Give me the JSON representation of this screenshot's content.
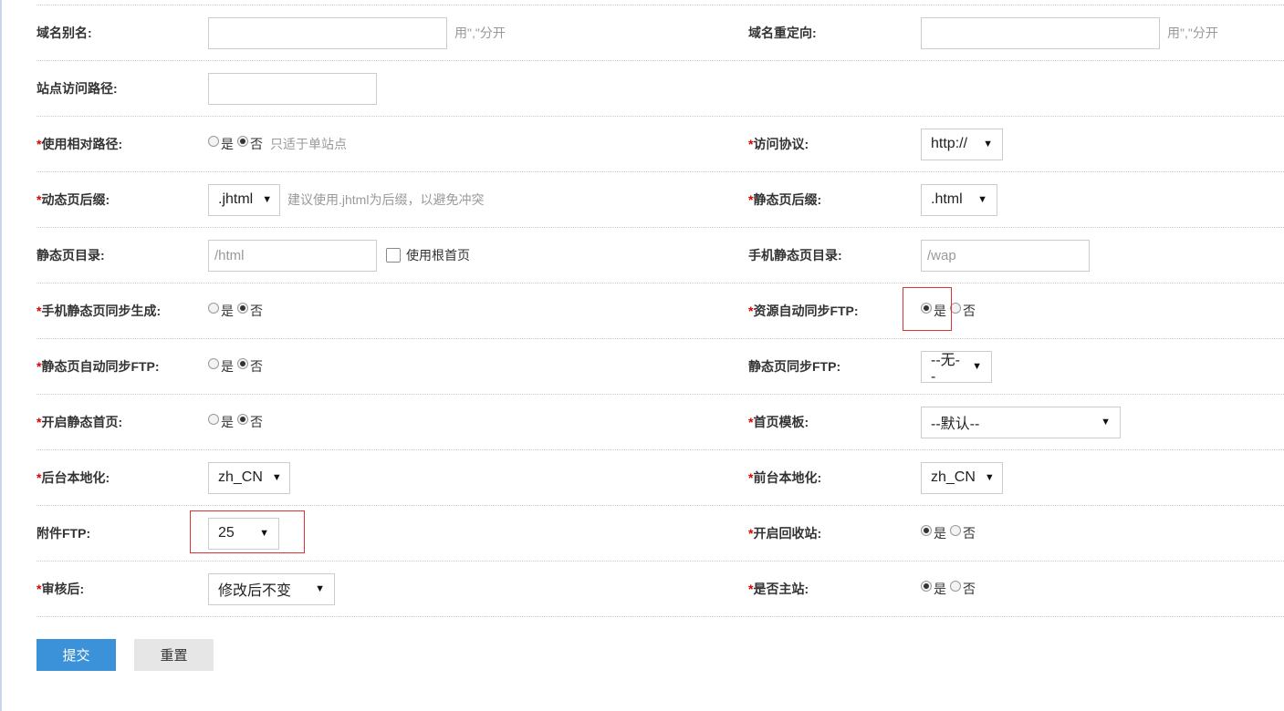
{
  "required_mark": "*",
  "rows": {
    "domain_alias": {
      "label": "域名别名:",
      "value": "",
      "hint": "用\",\"分开"
    },
    "domain_redirect": {
      "label": "域名重定向:",
      "value": "",
      "hint": "用\",\"分开"
    },
    "site_path": {
      "label": "站点访问路径:",
      "value": ""
    },
    "relative_path": {
      "label": "使用相对路径:",
      "yes": "是",
      "no": "否",
      "selected": "否",
      "hint": "只适于单站点"
    },
    "protocol": {
      "label": "访问协议:",
      "value": "http://"
    },
    "dynamic_suffix": {
      "label": "动态页后缀:",
      "value": ".jhtml",
      "hint": "建议使用.jhtml为后缀，以避免冲突"
    },
    "static_suffix": {
      "label": "静态页后缀:",
      "value": ".html"
    },
    "static_dir": {
      "label": "静态页目录:",
      "placeholder": "/html",
      "checkbox_label": "使用根首页"
    },
    "mobile_static_dir": {
      "label": "手机静态页目录:",
      "placeholder": "/wap"
    },
    "mobile_sync": {
      "label": "手机静态页同步生成:",
      "yes": "是",
      "no": "否",
      "selected": "否"
    },
    "res_ftp": {
      "label": "资源自动同步FTP:",
      "yes": "是",
      "no": "否",
      "selected": "是"
    },
    "static_auto_ftp": {
      "label": "静态页自动同步FTP:",
      "yes": "是",
      "no": "否",
      "selected": "否"
    },
    "static_ftp": {
      "label": "静态页同步FTP:",
      "value": "--无--"
    },
    "static_index": {
      "label": "开启静态首页:",
      "yes": "是",
      "no": "否",
      "selected": "否"
    },
    "index_tpl": {
      "label": "首页模板:",
      "value": "--默认--"
    },
    "admin_locale": {
      "label": "后台本地化:",
      "value": "zh_CN"
    },
    "front_locale": {
      "label": "前台本地化:",
      "value": "zh_CN"
    },
    "attach_ftp": {
      "label": "附件FTP:",
      "value": "25"
    },
    "recycle": {
      "label": "开启回收站:",
      "yes": "是",
      "no": "否",
      "selected": "是"
    },
    "after_audit": {
      "label": "审核后:",
      "value": "修改后不变"
    },
    "master_site": {
      "label": "是否主站:",
      "yes": "是",
      "no": "否",
      "selected": "是"
    }
  },
  "buttons": {
    "submit": "提交",
    "reset": "重置"
  },
  "colors": {
    "required": "#dd0000",
    "highlight": "#dd3333",
    "primary": "#3b92d8"
  }
}
